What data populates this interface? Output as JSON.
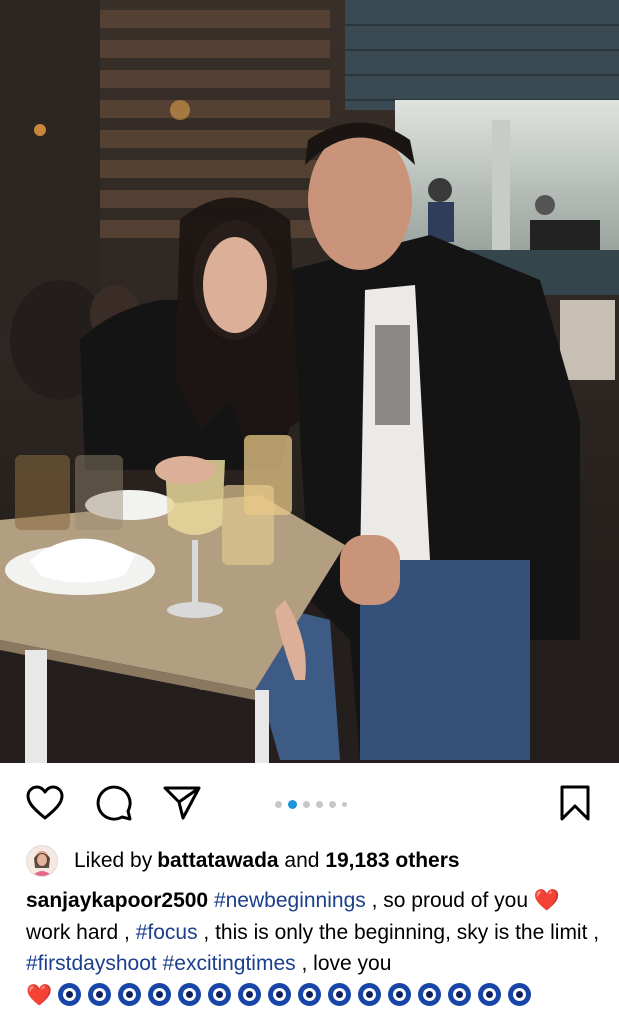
{
  "post": {
    "image_alt": "Man in black blazer and woman with long dark hair seated at a restaurant table at night",
    "carousel": {
      "total": 6,
      "active": 2
    },
    "icons": {
      "like": "heart-outline-icon",
      "comment": "comment-bubble-icon",
      "share": "send-paper-plane-icon",
      "save": "bookmark-icon"
    }
  },
  "likes": {
    "prefix": "Liked by ",
    "user": "battatawada",
    "connector": " and ",
    "count": "19,183 others"
  },
  "caption": {
    "username": "sanjaykapoor2500",
    "tag1": "#newbeginnings",
    "text1": " , so proud of you ",
    "heart1": "❤️",
    "text2": " work hard , ",
    "tag2": "#focus",
    "text3": " , this is only the beginning, sky is the limit , ",
    "tag3": "#firstdayshoot",
    "tag4": "#excitingtimes",
    "text4": " , love you ",
    "heart2": "❤️",
    "evil_eye_count": 16
  }
}
